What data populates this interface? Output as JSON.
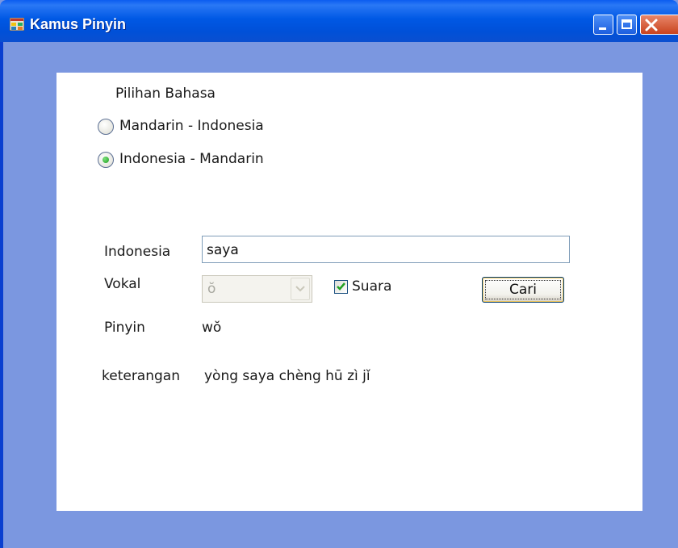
{
  "window": {
    "title": "Kamus Pinyin",
    "colors": {
      "titlebar": "#0058e4",
      "client_area": "#7b97e0",
      "panel": "#ffffff"
    }
  },
  "language_choice": {
    "heading": "Pilihan Bahasa",
    "options": [
      {
        "label": "Mandarin - Indonesia",
        "selected": false
      },
      {
        "label": "Indonesia - Mandarin",
        "selected": true
      }
    ]
  },
  "form": {
    "indonesia_label": "Indonesia",
    "indonesia_value": "saya",
    "vokal_label": "Vokal",
    "vokal_value": "ŏ",
    "vokal_enabled": false,
    "suara_label": "Suara",
    "suara_checked": true,
    "search_button": "Cari",
    "pinyin_label": "Pinyin",
    "pinyin_value": "wŏ",
    "keterangan_label": "keterangan",
    "keterangan_value": "yòng saya chèng hū zì jǐ"
  },
  "icons": {
    "app": "app-window-icon",
    "minimize": "minimize-icon",
    "maximize": "maximize-icon",
    "close": "close-icon",
    "dropdown": "chevron-down-icon",
    "check": "checkmark-icon"
  }
}
